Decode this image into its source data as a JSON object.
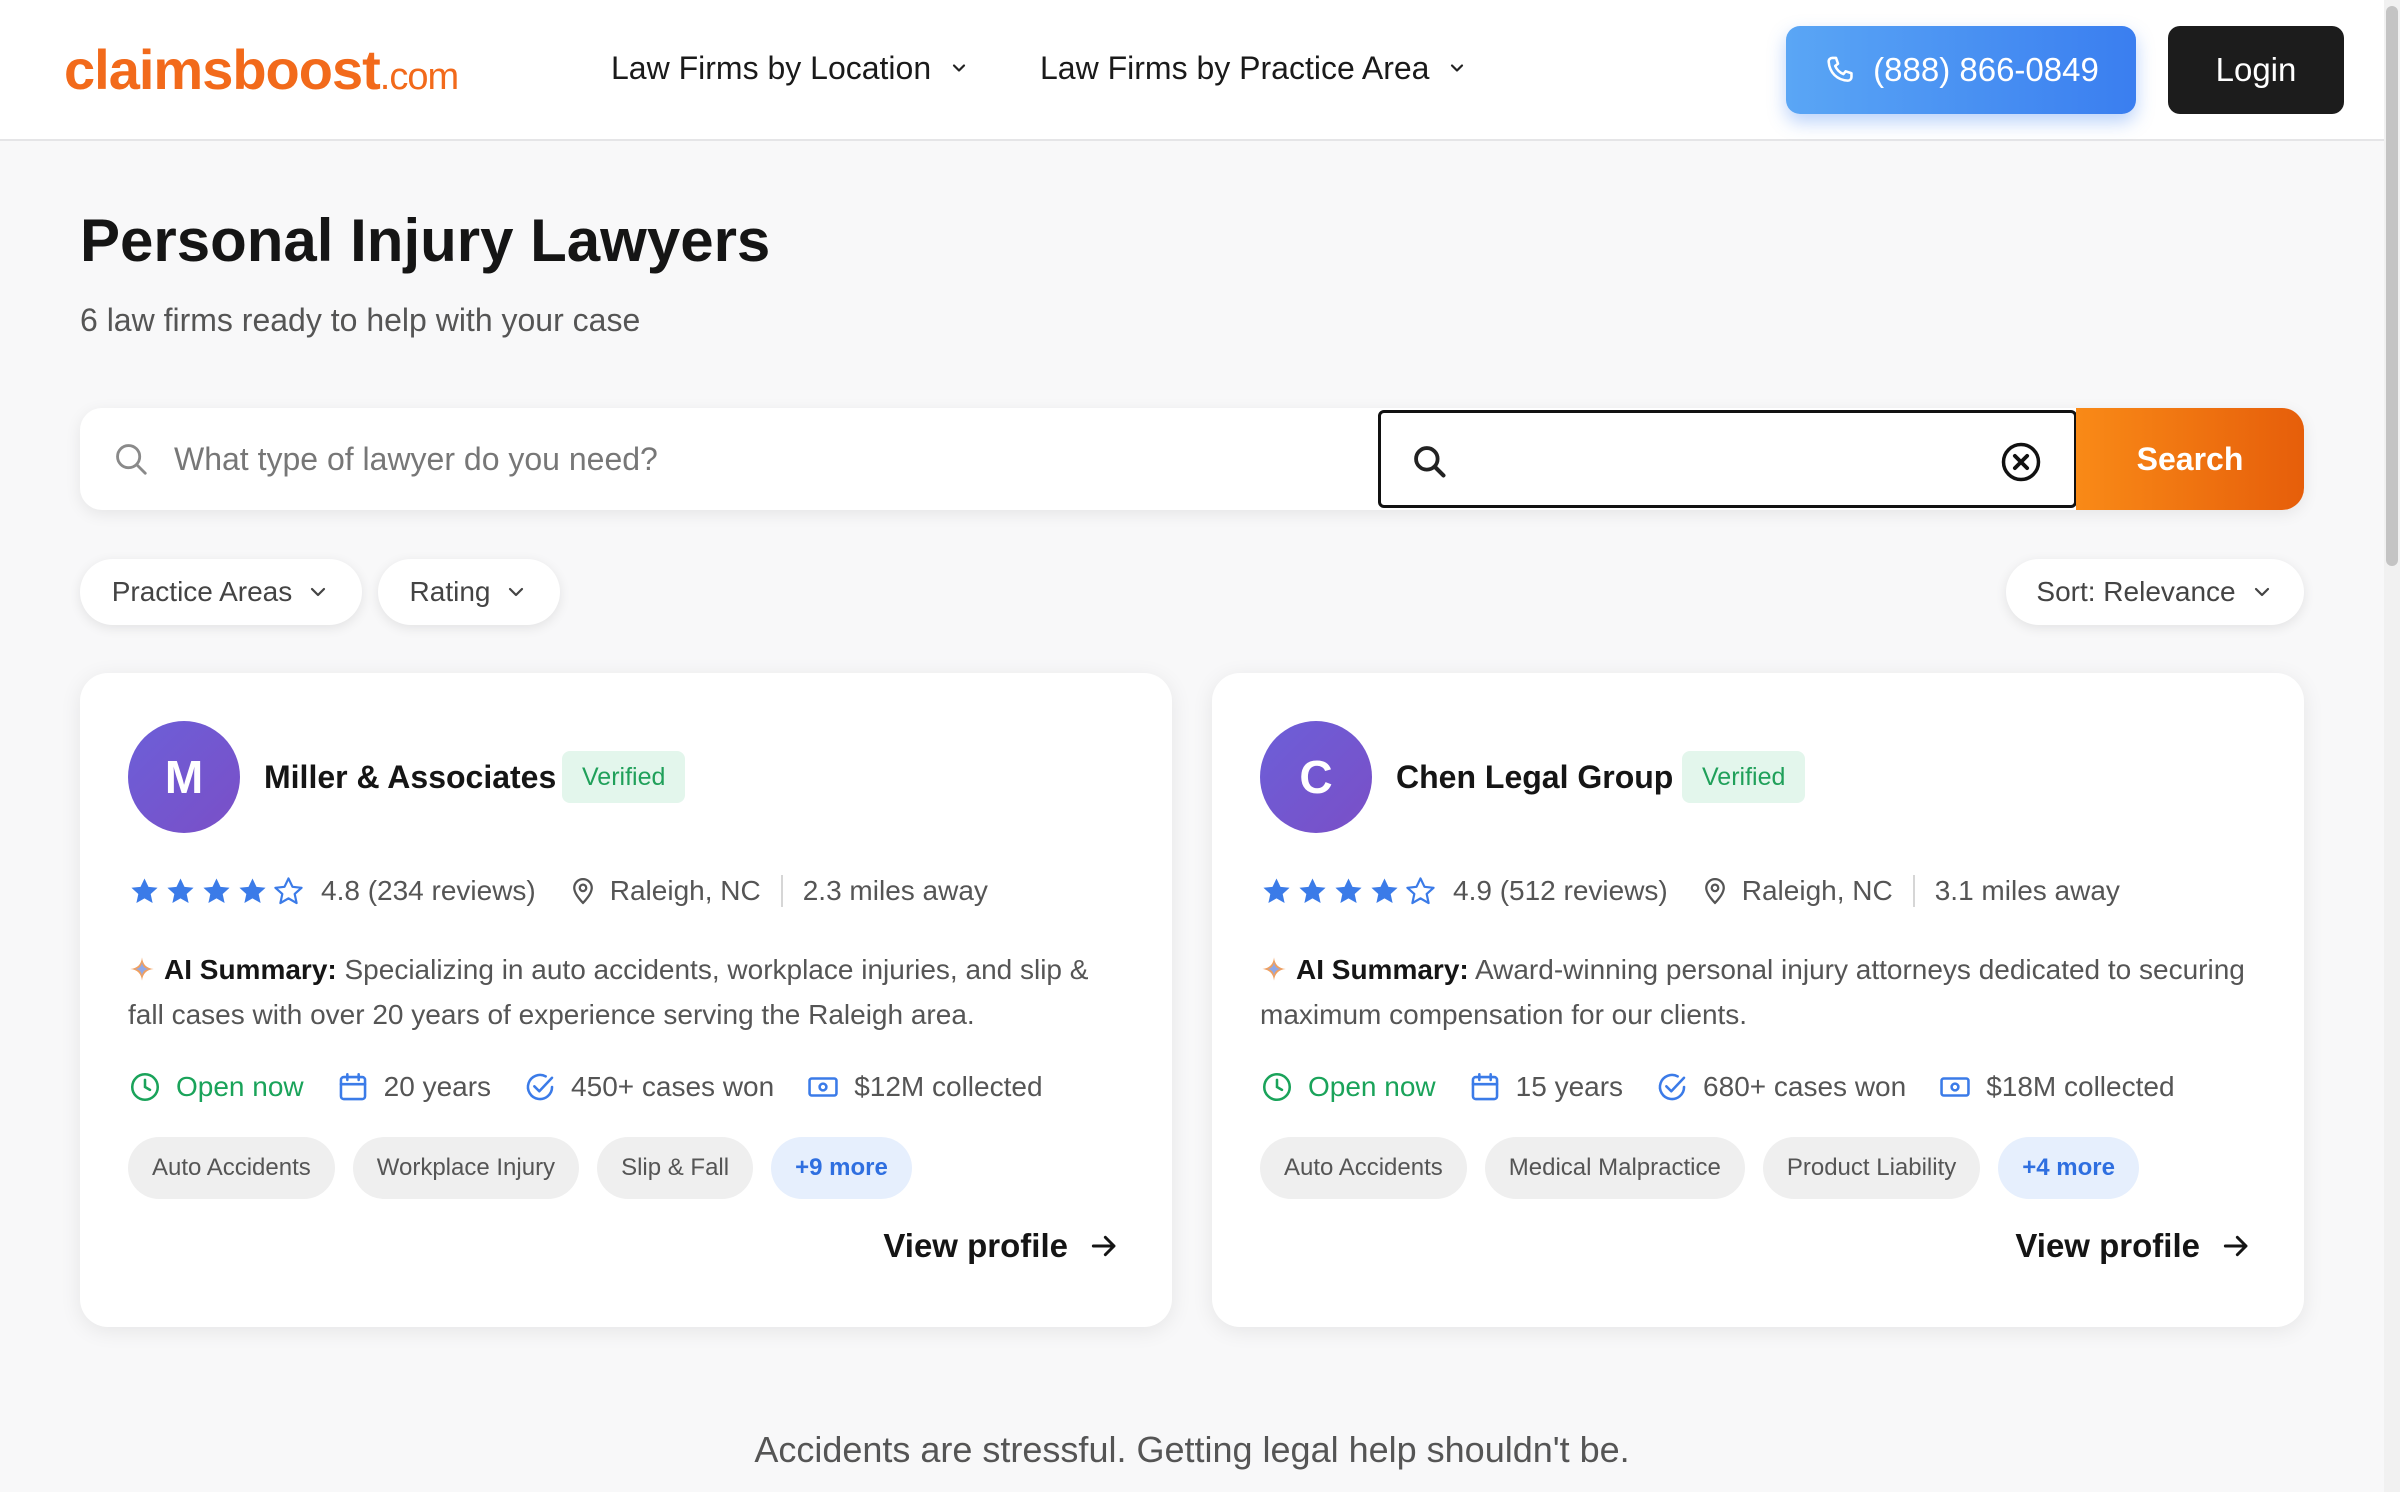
{
  "header": {
    "logo_main": "claimsboost",
    "logo_tld": ".com",
    "nav": [
      {
        "label": "Law Firms by Location"
      },
      {
        "label": "Law Firms by Practice Area"
      }
    ],
    "phone": "(888) 866-0849",
    "login": "Login"
  },
  "page": {
    "title": "Personal Injury Lawyers",
    "subtitle": "6 law firms ready to help with your case"
  },
  "search": {
    "placeholder": "What type of lawyer do you need?",
    "location_value": "",
    "button": "Search"
  },
  "filters": {
    "practice_areas": "Practice Areas",
    "rating": "Rating",
    "sort": "Sort: Relevance"
  },
  "firms": [
    {
      "initial": "M",
      "name": "Miller & Associates",
      "badge": "Verified",
      "rating_text": "4.8 (234 reviews)",
      "stars_filled": 4,
      "location": "Raleigh, NC",
      "distance": "2.3 miles away",
      "summary_label": "AI Summary:",
      "summary": "Specializing in auto accidents, workplace injuries, and slip & fall cases with over 20 years of experience serving the Raleigh area.",
      "open": "Open now",
      "years": "20 years",
      "cases": "450+ cases won",
      "collected": "$12M collected",
      "tags": [
        "Auto Accidents",
        "Workplace Injury",
        "Slip & Fall"
      ],
      "more": "+9 more",
      "cta": "View profile"
    },
    {
      "initial": "C",
      "name": "Chen Legal Group",
      "badge": "Verified",
      "rating_text": "4.9 (512 reviews)",
      "stars_filled": 4,
      "location": "Raleigh, NC",
      "distance": "3.1 miles away",
      "summary_label": "AI Summary:",
      "summary": "Award-winning personal injury attorneys dedicated to securing maximum compensation for our clients.",
      "open": "Open now",
      "years": "15 years",
      "cases": "680+ cases won",
      "collected": "$18M collected",
      "tags": [
        "Auto Accidents",
        "Medical Malpractice",
        "Product Liability"
      ],
      "more": "+4 more",
      "cta": "View profile"
    }
  ],
  "footer": {
    "tagline": "Accidents are stressful. Getting legal help shouldn't be."
  },
  "colors": {
    "brand_orange": "#f26a1b",
    "accent_blue": "#3a7ef0",
    "star_blue": "#3b7be8",
    "open_green": "#1aa35a"
  },
  "icons": [
    "phone-icon",
    "chevron-down-icon",
    "search-icon",
    "clear-icon",
    "star-icon",
    "location-pin-icon",
    "sparkle-icon",
    "clock-icon",
    "calendar-icon",
    "check-circle-icon",
    "money-icon",
    "arrow-right-icon"
  ]
}
